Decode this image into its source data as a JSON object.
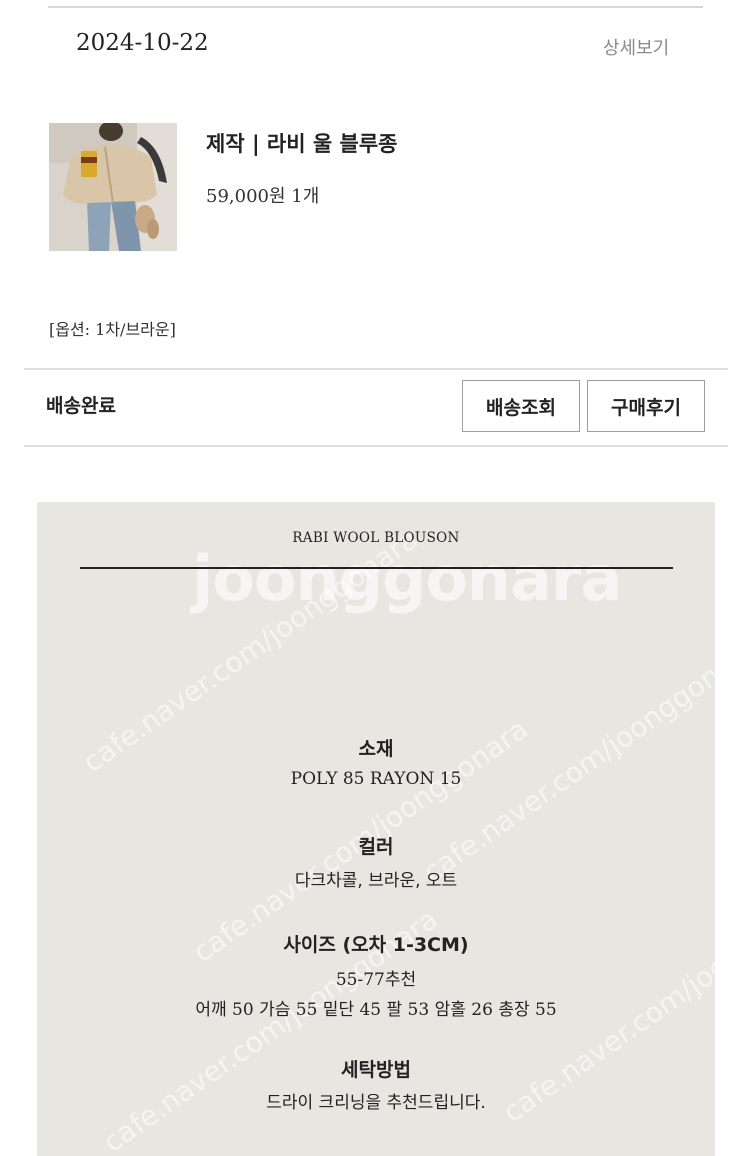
{
  "order": {
    "date": "2024-10-22",
    "detail_link": "상세보기"
  },
  "product": {
    "name": "제작 | 라비 울 블루종",
    "price_qty": "59,000원 1개",
    "option": "[옵션: 1차/브라운]",
    "thumbnail_icon": "product-photo"
  },
  "shipping": {
    "status": "배송완료",
    "track_button": "배송조회",
    "review_button": "구매후기"
  },
  "detail_image": {
    "title": "RABI WOOL BLOUSON",
    "watermark": "joonggonara",
    "watermark_small": "cafe.naver.com/joonggonara",
    "sections": [
      {
        "heading": "소재",
        "lines": [
          "POLY 85 RAYON 15"
        ]
      },
      {
        "heading": "컬러",
        "lines": [
          "다크차콜, 브라운, 오트"
        ]
      },
      {
        "heading": "사이즈 (오차 1-3CM)",
        "lines": [
          "55-77추천",
          "어깨 50 가슴 55 밑단 45 팔 53 암홀 26 총장 55"
        ]
      },
      {
        "heading": "세탁방법",
        "lines": [
          "드라이 크리닝을 추천드립니다."
        ]
      }
    ]
  }
}
